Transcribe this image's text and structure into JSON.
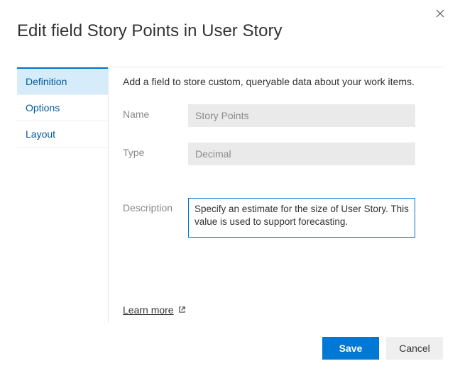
{
  "dialog": {
    "title": "Edit field Story Points in User Story"
  },
  "sidebar": {
    "items": [
      {
        "label": "Definition",
        "active": true
      },
      {
        "label": "Options",
        "active": false
      },
      {
        "label": "Layout",
        "active": false
      }
    ]
  },
  "main": {
    "intro": "Add a field to store custom, queryable data about your work items.",
    "name_label": "Name",
    "name_value": "Story Points",
    "type_label": "Type",
    "type_value": "Decimal",
    "description_label": "Description",
    "description_value": "Specify an estimate for the size of User Story. This value is used to support forecasting.",
    "learn_more": "Learn more"
  },
  "footer": {
    "save_label": "Save",
    "cancel_label": "Cancel"
  }
}
